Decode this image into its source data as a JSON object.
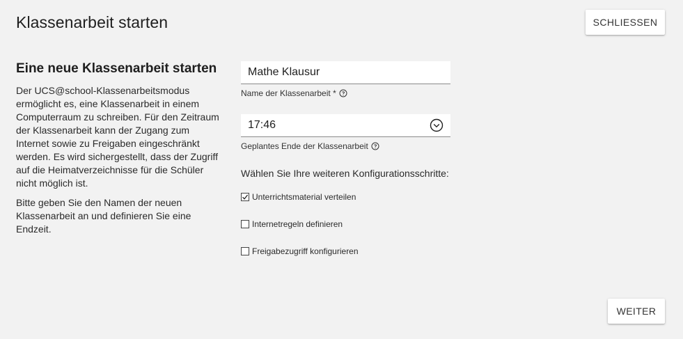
{
  "header": {
    "title": "Klassenarbeit starten",
    "close_label": "SCHLIESSEN"
  },
  "intro": {
    "heading": "Eine neue Klassenarbeit starten",
    "paragraph1": "Der UCS@school-Klassenarbeitsmodus ermöglicht es, eine Klassenarbeit in einem Computerraum zu schreiben. Für den Zeitraum der Klassenarbeit kann der Zugang zum Internet sowie zu Freigaben eingeschränkt werden. Es wird sichergestellt, dass der Zugriff auf die Heimatverzeichnisse für die Schüler nicht möglich ist.",
    "paragraph2": "Bitte geben Sie den Namen der neuen Klassenarbeit an und definieren Sie eine Endzeit."
  },
  "form": {
    "name": {
      "value": "Mathe Klausur",
      "label": "Name der Klassenarbeit *"
    },
    "end_time": {
      "value": "17:46",
      "label": "Geplantes Ende der Klassenarbeit"
    },
    "config_heading": "Wählen Sie Ihre weiteren Konfigurationsschritte:",
    "options": [
      {
        "label": "Unterrichtsmaterial verteilen",
        "checked": true
      },
      {
        "label": "Internetregeln definieren",
        "checked": false
      },
      {
        "label": "Freigabezugriff konfigurieren",
        "checked": false
      }
    ]
  },
  "footer": {
    "next_label": "WEITER"
  },
  "icons": {
    "help": "help-circle-icon",
    "clock": "clock-chevron-icon",
    "check": "checkmark-icon"
  }
}
